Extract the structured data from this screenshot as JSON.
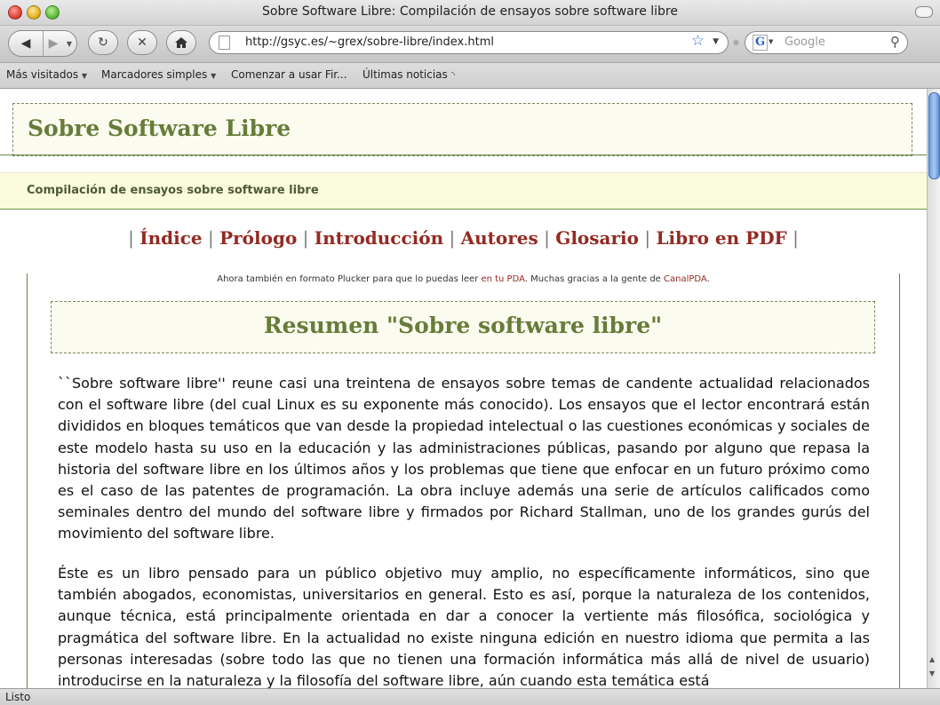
{
  "window": {
    "title": "Sobre Software Libre: Compilación de ensayos sobre software libre"
  },
  "toolbar": {
    "url": "http://gsyc.es/~grex/sobre-libre/index.html",
    "search_placeholder": "Google"
  },
  "bookmarks": [
    {
      "label": "Más visitados",
      "has_menu": true
    },
    {
      "label": "Marcadores simples",
      "has_menu": true
    },
    {
      "label": "Comenzar a usar Fir...",
      "has_menu": false
    },
    {
      "label": "Últimas noticias",
      "has_menu": false
    }
  ],
  "status": {
    "text": "Listo"
  },
  "page": {
    "site_title": "Sobre Software Libre",
    "subtitle": "Compilación de ensayos sobre software libre",
    "nav": [
      {
        "label": "Índice"
      },
      {
        "label": "Prólogo"
      },
      {
        "label": "Introducción"
      },
      {
        "label": "Autores"
      },
      {
        "label": "Glosario"
      },
      {
        "label": "Libro en PDF"
      }
    ],
    "notice": {
      "pre": "Ahora también en formato Plucker para que lo puedas leer ",
      "link1": "en tu PDA",
      "mid": ". Muchas gracias a la gente de ",
      "link2": "CanalPDA",
      "post": "."
    },
    "resumen_title": "Resumen \"Sobre software libre\"",
    "paragraphs": [
      "``Sobre software libre'' reune casi una treintena de ensayos sobre temas de candente actualidad relacionados con el software libre (del cual Linux es su exponente más conocido). Los ensayos que el lector encontrará están divididos en bloques temáticos que van desde la propiedad intelectual o las cuestiones económicas y sociales de este modelo hasta su uso en la educación y las administraciones públicas, pasando por alguno que repasa la historia del software libre en los últimos años y los problemas que tiene que enfocar en un futuro próximo como es el caso de las patentes de programación. La obra incluye además una serie de artículos calificados como seminales dentro del mundo del software libre y firmados por Richard Stallman, uno de los grandes gurús del movimiento del software libre.",
      "Éste es un libro pensado para un público objetivo muy amplio, no específicamente informáticos, sino que también abogados, economistas, universitarios en general. Esto es así, porque la naturaleza de los contenidos, aunque técnica, está principalmente orientada en dar a conocer la vertiente más filosófica, sociológica y pragmática del software libre. En la actualidad no existe ninguna edición en nuestro idioma que permita a las personas interesadas (sobre todo las que no tienen una formación informática más allá de nivel de usuario) introducirse en la naturaleza y la filosofía del software libre, aún cuando esta temática está"
    ]
  }
}
